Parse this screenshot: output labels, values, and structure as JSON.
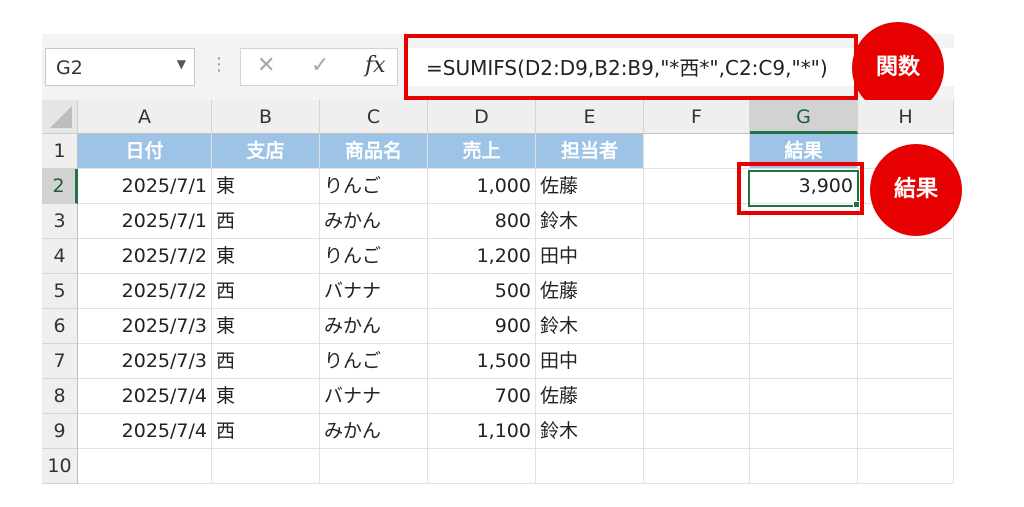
{
  "name_box": "G2",
  "formula_bar": {
    "cancel_icon": "✕",
    "enter_icon": "✓",
    "fx_label": "fx",
    "formula": "=SUMIFS(D2:D9,B2:B9,\"*西*\",C2:C9,\"*\")"
  },
  "callouts": {
    "function": "関数",
    "result": "結果"
  },
  "columns": [
    "A",
    "B",
    "C",
    "D",
    "E",
    "F",
    "G",
    "H"
  ],
  "rows": [
    "1",
    "2",
    "3",
    "4",
    "5",
    "6",
    "7",
    "8",
    "9",
    "10"
  ],
  "headers": {
    "A": "日付",
    "B": "支店",
    "C": "商品名",
    "D": "売上",
    "E": "担当者",
    "G": "結果"
  },
  "data": [
    [
      "2025/7/1",
      "東",
      "りんご",
      "1,000",
      "佐藤"
    ],
    [
      "2025/7/1",
      "西",
      "みかん",
      "800",
      "鈴木"
    ],
    [
      "2025/7/2",
      "東",
      "りんご",
      "1,200",
      "田中"
    ],
    [
      "2025/7/2",
      "西",
      "バナナ",
      "500",
      "佐藤"
    ],
    [
      "2025/7/3",
      "東",
      "みかん",
      "900",
      "鈴木"
    ],
    [
      "2025/7/3",
      "西",
      "りんご",
      "1,500",
      "田中"
    ],
    [
      "2025/7/4",
      "東",
      "バナナ",
      "700",
      "佐藤"
    ],
    [
      "2025/7/4",
      "西",
      "みかん",
      "1,100",
      "鈴木"
    ]
  ],
  "result_value": "3,900",
  "colors": {
    "header_fill": "#9dc3e6",
    "selection": "#217346",
    "callout": "#e60000"
  }
}
